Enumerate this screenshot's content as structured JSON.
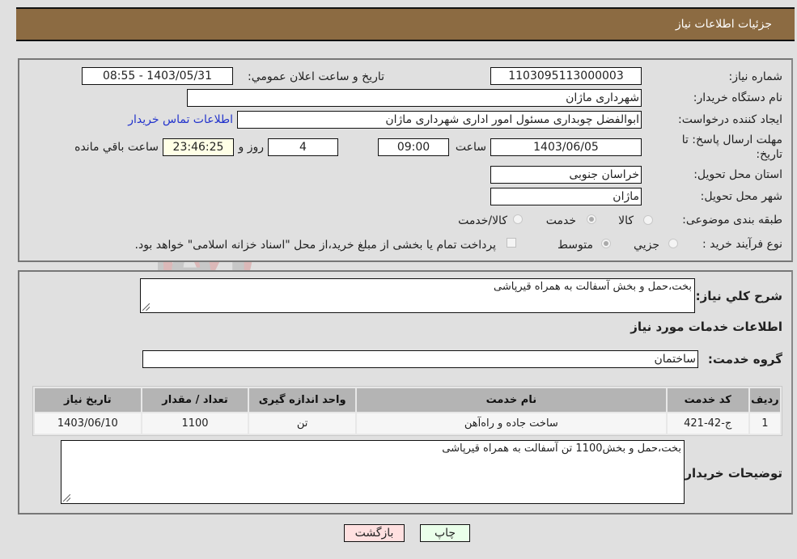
{
  "header": {
    "title": "جزئیات اطلاعات نیاز"
  },
  "info": {
    "need_number_label": "شماره نیاز:",
    "need_number": "1103095113000003",
    "announce_label": "تاریخ و ساعت اعلان عمومي:",
    "announce_value": "1403/05/31 - 08:55",
    "buyer_org_label": "نام دستگاه خریدار:",
    "buyer_org": "شهرداری ماژان",
    "creator_label": "ایجاد کننده درخواست:",
    "creator": "ابوالفضل چوبداری مسئول امور اداری شهرداری ماژان",
    "contact_link": "اطلاعات تماس خریدار",
    "deadline_label": "مهلت ارسال پاسخ: تا تاریخ:",
    "deadline_date": "1403/06/05",
    "time_label": "ساعت",
    "deadline_time": "09:00",
    "days_value": "4",
    "days_label": "روز و",
    "remaining_time": "23:46:25",
    "remaining_label": "ساعت باقي مانده",
    "province_label": "استان محل تحویل:",
    "province": "خراسان جنوبی",
    "city_label": "شهر محل تحویل:",
    "city": "ماژان",
    "category_label": "طبقه بندی موضوعی:",
    "category_options": [
      "کالا",
      "خدمت",
      "کالا/خدمت"
    ],
    "category_selected": "خدمت",
    "process_label": "نوع فرآیند خرید :",
    "process_options": [
      "جزيي",
      "متوسط"
    ],
    "process_selected": "متوسط",
    "treasury_note": "پرداخت تمام یا بخشی از مبلغ خرید،از محل \"اسناد خزانه اسلامی\" خواهد بود."
  },
  "details": {
    "summary_label": "شرح كلي نياز:",
    "summary": "بخت،حمل و بخش آسفالت به همراه قیرپاشی",
    "services_heading": "اطلاعات خدمات مورد نیاز",
    "service_group_label": "گروه خدمت:",
    "service_group": "ساختمان",
    "table": {
      "headers": [
        "ردیف",
        "کد خدمت",
        "نام خدمت",
        "واحد اندازه گیری",
        "تعداد / مقدار",
        "تاریخ نیاز"
      ],
      "rows": [
        [
          "1",
          "ج-42-421",
          "ساخت جاده و راه‌آهن",
          "تن",
          "1100",
          "1403/06/10"
        ]
      ]
    },
    "buyer_notes_label": "توضیحات خریدار:",
    "buyer_notes": "بخت،حمل و بخش1100 تن آسفالت به همراه قیرپاشی"
  },
  "buttons": {
    "print": "چاپ",
    "back": "بازگشت"
  },
  "watermark": "AriaTender.neT",
  "colors": {
    "header_bg": "#8c6b42",
    "print_bg": "#eaffea",
    "back_bg": "#ffe0e0",
    "link": "#2233cc"
  }
}
